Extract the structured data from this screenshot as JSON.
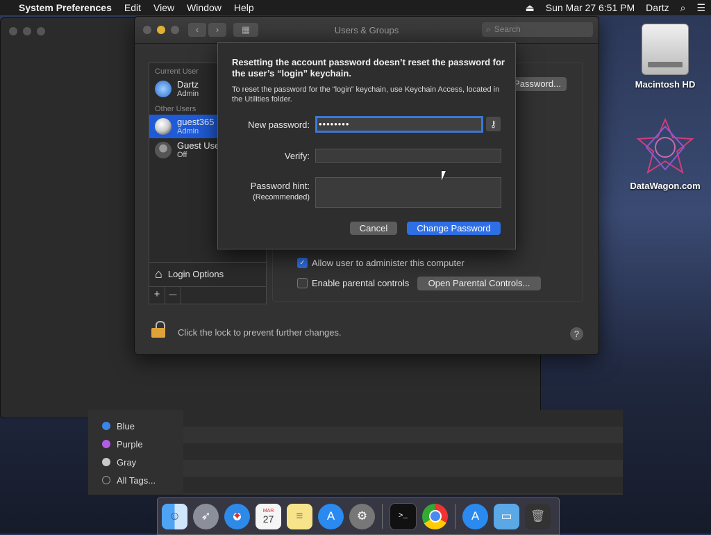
{
  "menubar": {
    "apple": "",
    "app_name": "System Preferences",
    "items": [
      "Edit",
      "View",
      "Window",
      "Help"
    ],
    "eject": "⏏",
    "datetime": "Sun Mar 27  6:51 PM",
    "user": "Dartz",
    "search_icon": "⌕",
    "list_icon": "☰"
  },
  "desktop": {
    "hd_label": "Macintosh HD",
    "datawagon_label": "DataWagon.com"
  },
  "finder": {
    "tags": [
      {
        "label": "Blue",
        "color": "#3a86e8"
      },
      {
        "label": "Purple",
        "color": "#b45ce6"
      },
      {
        "label": "Gray",
        "color": "#c8c8c8"
      },
      {
        "label": "All Tags...",
        "color": "transparent"
      }
    ]
  },
  "window": {
    "title": "Users & Groups",
    "back": "‹",
    "forward": "›",
    "grid": "▦",
    "search_placeholder": "Search",
    "current_user_header": "Current User",
    "other_users_header": "Other Users",
    "users": [
      {
        "name": "Dartz",
        "role": "Admin"
      },
      {
        "name": "guest365",
        "role": "Admin"
      },
      {
        "name": "Guest User",
        "role": "Off"
      }
    ],
    "login_options": "Login Options",
    "plus": "+",
    "minus": "—",
    "change_password_btn": "Password...",
    "allow_admin": "Allow user to administer this computer",
    "parental_controls": "Enable parental controls",
    "open_parental": "Open Parental Controls...",
    "lock_text": "Click the lock to prevent further changes.",
    "help": "?"
  },
  "sheet": {
    "heading": "Resetting the account password doesn’t reset the password for the user’s “login” keychain.",
    "body": "To reset the password for the “login” keychain, use Keychain Access, located in the Utilities folder.",
    "new_password_label": "New password:",
    "new_password_value": "••••••••",
    "key_icon": "⚷",
    "verify_label": "Verify:",
    "hint_label": "Password hint:",
    "hint_sub": "(Recommended)",
    "cancel": "Cancel",
    "change": "Change Password"
  },
  "dock": {
    "calendar_month": "MAR",
    "calendar_day": "27",
    "terminal": ">_"
  }
}
